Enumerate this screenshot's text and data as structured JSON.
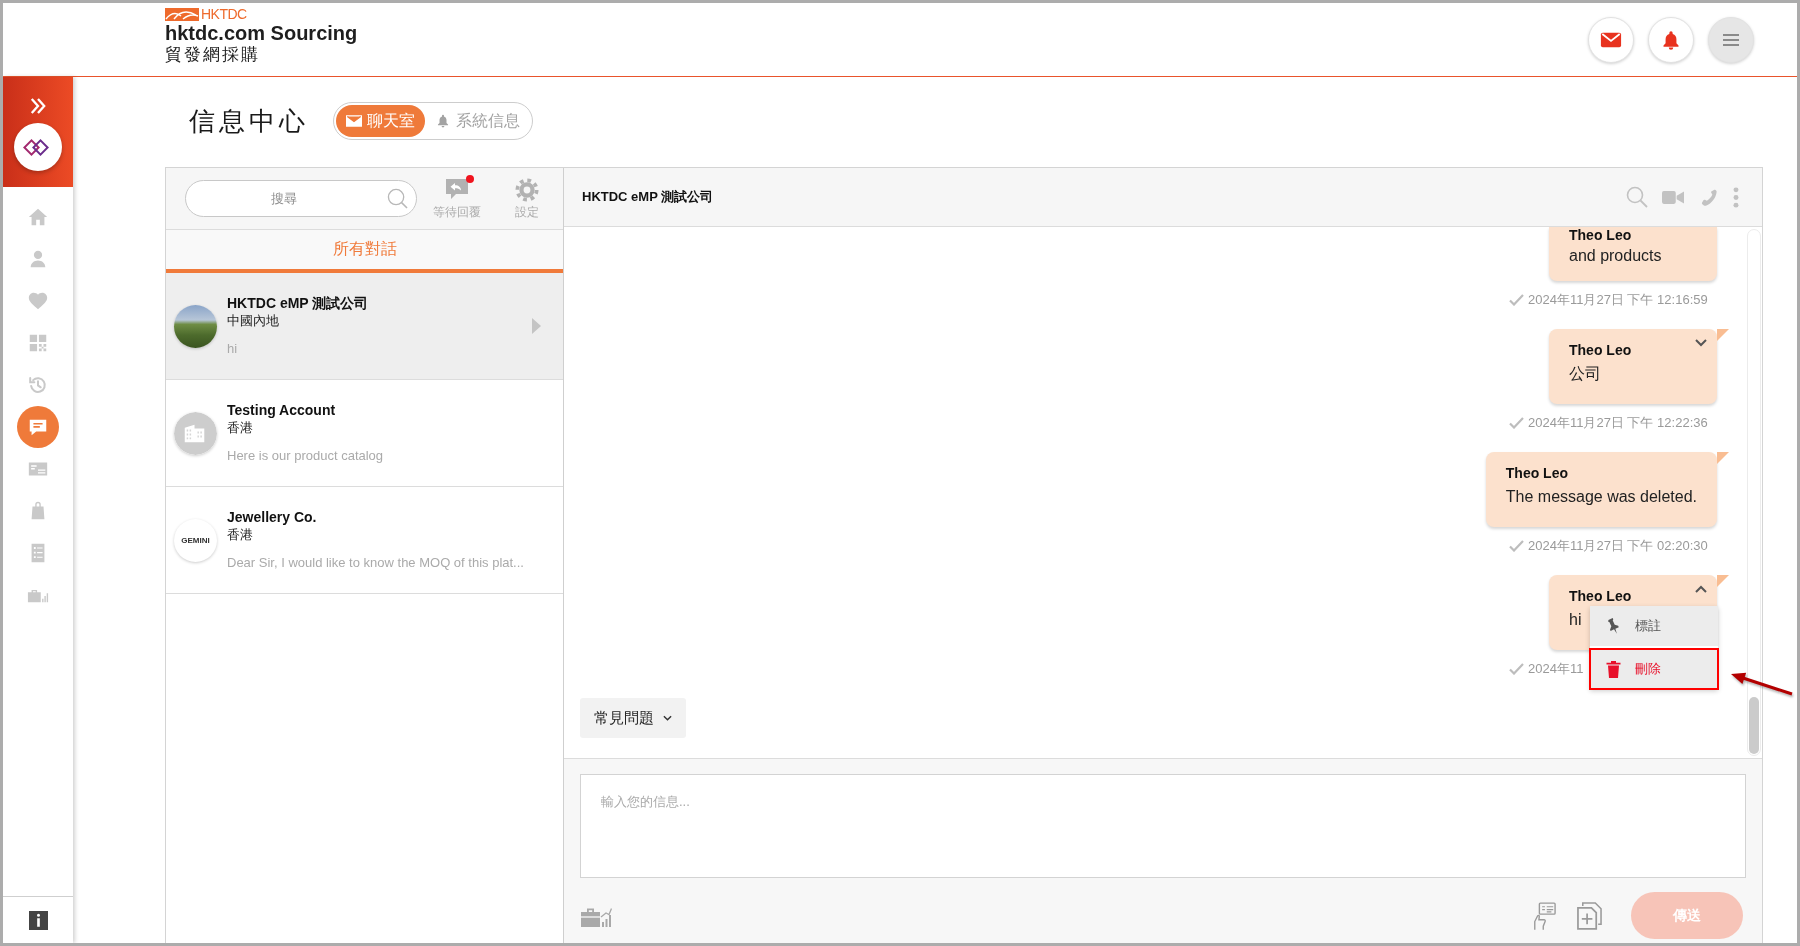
{
  "header": {
    "brand_mark": "HKTDC",
    "title": "hktdc.com Sourcing",
    "subtitle": "貿發網採購"
  },
  "sidebar": {
    "items": [
      {
        "selected": false
      },
      {
        "selected": false
      },
      {
        "selected": false
      },
      {
        "selected": false
      },
      {
        "selected": false
      },
      {
        "selected": true
      },
      {
        "selected": false
      },
      {
        "selected": false
      },
      {
        "selected": false
      },
      {
        "selected": false
      }
    ]
  },
  "page": {
    "title": "信息中心",
    "tabs": [
      {
        "label": "聊天室",
        "selected": true
      },
      {
        "label": "系統信息",
        "selected": false
      }
    ]
  },
  "conversation_panel": {
    "search": {
      "placeholder": "搜尋"
    },
    "tools": [
      {
        "label": "等待回覆",
        "notification": true
      },
      {
        "label": "設定",
        "notification": false
      }
    ],
    "filter_tab": {
      "label": "所有對話",
      "selected": true
    },
    "conversations": [
      {
        "name": "HKTDC eMP 測試公司",
        "region": "中國內地",
        "preview": "hi",
        "selected": true,
        "avatar": {
          "kind": "photo"
        }
      },
      {
        "name": "Testing Account",
        "region": "香港",
        "preview": "Here is our product catalog",
        "selected": false,
        "avatar": {
          "kind": "placeholder"
        }
      },
      {
        "name": "Jewellery Co.",
        "region": "香港",
        "preview": "Dear Sir, I would like to know the MOQ of this plat...",
        "selected": false,
        "avatar": {
          "kind": "logo",
          "text": "GEMINI"
        }
      }
    ]
  },
  "chat": {
    "title": "HKTDC eMP 測試公司",
    "messages": [
      {
        "sender": "Theo Leo",
        "text": "and products",
        "time": "2024年11月27日 下午 12:16:59",
        "read": true,
        "partial": true,
        "hovered": false,
        "menu_open": false
      },
      {
        "sender": "Theo Leo",
        "text": "公司",
        "time": "2024年11月27日 下午 12:22:36",
        "read": true,
        "partial": false,
        "hovered": true,
        "menu_open": false
      },
      {
        "sender": "Theo Leo",
        "text": "The message was deleted.",
        "time": "2024年11月27日 下午 02:20:30",
        "read": true,
        "partial": false,
        "hovered": false,
        "menu_open": false
      },
      {
        "sender": "Theo Leo",
        "text": "hi",
        "time": "2024年11",
        "read": true,
        "partial": false,
        "hovered": true,
        "menu_open": true
      }
    ],
    "context_menu": {
      "items": [
        {
          "label": "標註",
          "danger": false,
          "highlighted": false
        },
        {
          "label": "刪除",
          "danger": true,
          "highlighted": true
        }
      ]
    },
    "faq_button": {
      "label": "常見問題"
    },
    "composer": {
      "placeholder": "輸入您的信息...",
      "send_button": {
        "label": "傳送",
        "disabled": true
      }
    }
  }
}
